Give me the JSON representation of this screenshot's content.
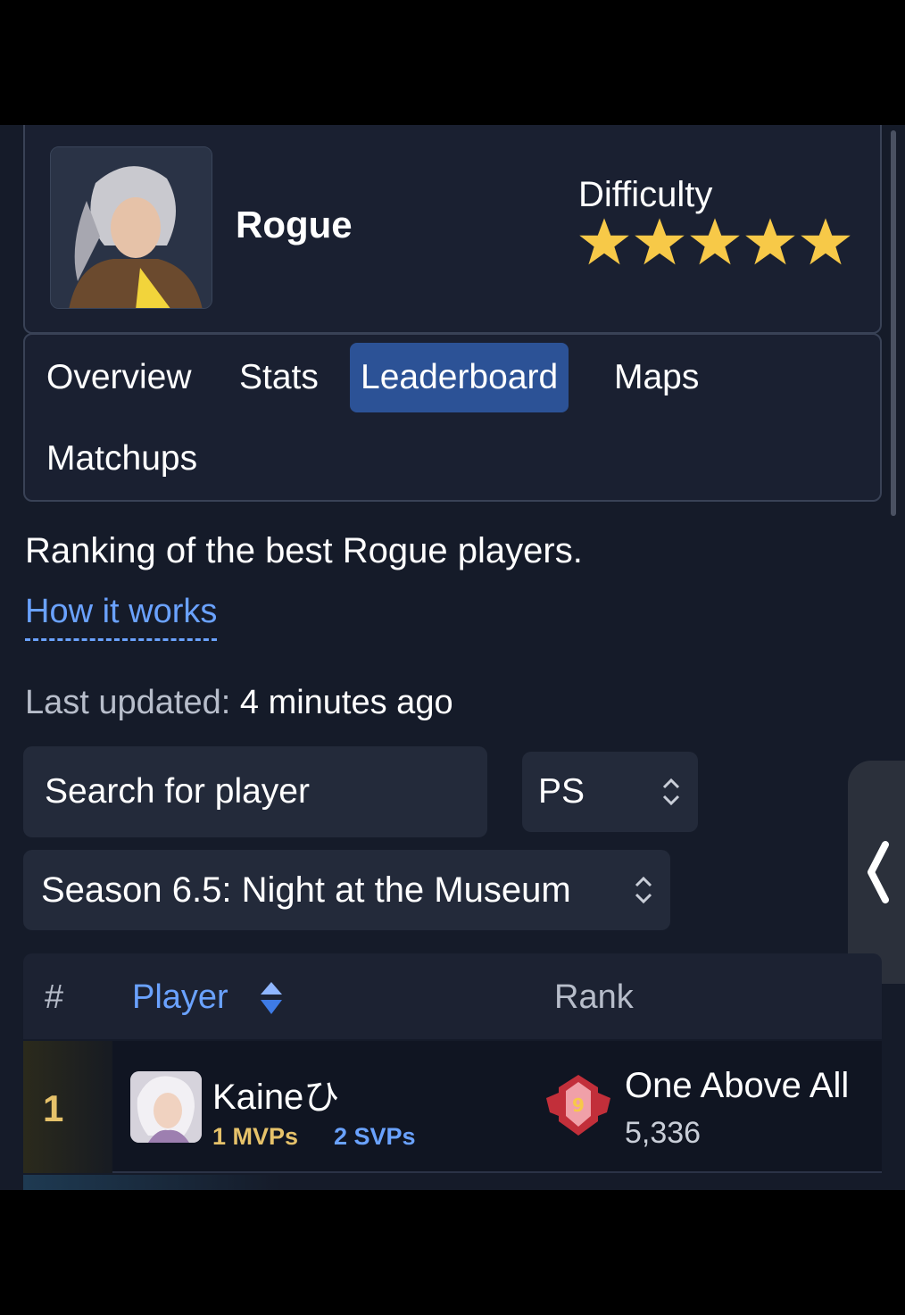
{
  "hero": {
    "name": "Rogue",
    "difficulty_label": "Difficulty",
    "difficulty_stars": 5,
    "star_color": "#f7c948"
  },
  "tabs": [
    {
      "label": "Overview",
      "active": false
    },
    {
      "label": "Stats",
      "active": false
    },
    {
      "label": "Leaderboard",
      "active": true
    },
    {
      "label": "Maps",
      "active": false
    },
    {
      "label": "Matchups",
      "active": false
    }
  ],
  "description": "Ranking of the best Rogue players.",
  "how_it_works": "How it works",
  "last_updated": {
    "label": "Last updated:",
    "value": "4 minutes ago"
  },
  "search": {
    "placeholder": "Search for player"
  },
  "platform": {
    "selected": "PS"
  },
  "season": {
    "selected": "Season 6.5: Night at the Museum"
  },
  "table": {
    "headers": {
      "num": "#",
      "player": "Player",
      "rank": "Rank"
    },
    "rows": [
      {
        "position": "1",
        "player": "Kaineひ",
        "mvps": "1 MVPs",
        "svps": "2 SVPs",
        "rank_name": "One Above All",
        "score": "5,336"
      }
    ]
  },
  "colors": {
    "accent": "#6aa2ff",
    "active_tab": "#2c5296",
    "gold": "#e6c26a"
  }
}
